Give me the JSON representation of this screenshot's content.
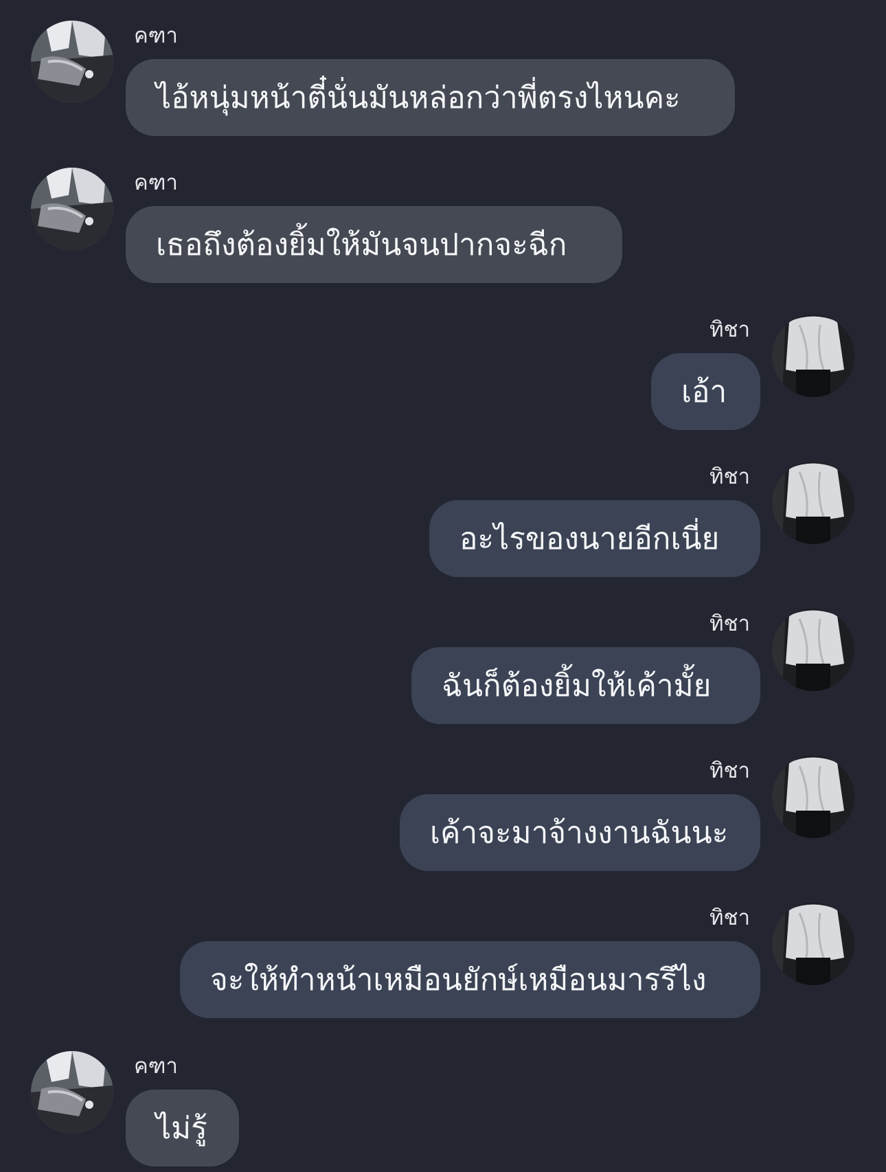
{
  "messages": [
    {
      "sender": "คฑา",
      "side": "left",
      "avatar": "avatar-khatha",
      "text": "ไอ้หนุ่มหน้าตี๋นั่นมันหล่อกว่าพี่ตรงไหนคะ"
    },
    {
      "sender": "คฑา",
      "side": "left",
      "avatar": "avatar-khatha",
      "text": "เธอถึงต้องยิ้มให้มันจนปากจะฉีก"
    },
    {
      "sender": "ทิชา",
      "side": "right",
      "avatar": "avatar-thicha",
      "text": "เอ้า"
    },
    {
      "sender": "ทิชา",
      "side": "right",
      "avatar": "avatar-thicha",
      "text": "อะไรของนายอีกเนี่ย"
    },
    {
      "sender": "ทิชา",
      "side": "right",
      "avatar": "avatar-thicha",
      "text": "ฉันก็ต้องยิ้มให้เค้ามั้ย"
    },
    {
      "sender": "ทิชา",
      "side": "right",
      "avatar": "avatar-thicha",
      "text": "เค้าจะมาจ้างงานฉันนะ"
    },
    {
      "sender": "ทิชา",
      "side": "right",
      "avatar": "avatar-thicha",
      "text": "จะให้ทำหน้าเหมือนยักษ์เหมือนมารรึไง"
    },
    {
      "sender": "คฑา",
      "side": "left",
      "avatar": "avatar-khatha",
      "text": "ไม่รู้"
    }
  ],
  "colors": {
    "background": "#232631",
    "bubble_left": "#454953",
    "bubble_right": "#3b4355",
    "text": "#f5f6f8"
  }
}
